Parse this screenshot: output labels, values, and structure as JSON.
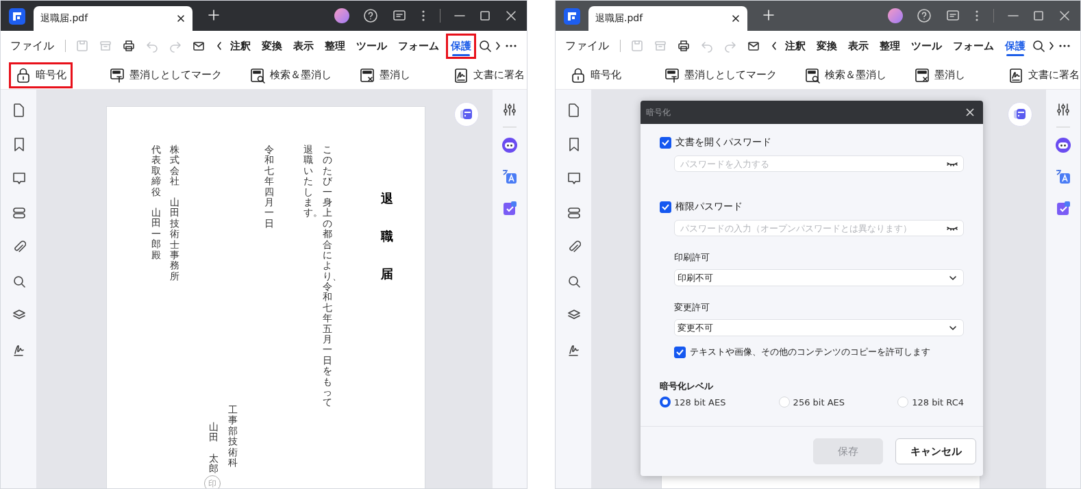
{
  "windows": [
    {
      "tab_title": "退職届.pdf",
      "menu": "ファイル",
      "quick_actions": [
        {
          "disabled": true
        },
        {
          "disabled": true
        },
        {
          "disabled": false
        },
        {
          "disabled": true
        },
        {
          "disabled": true
        },
        {
          "disabled": false
        }
      ],
      "tabs": [
        {
          "label": "注釈",
          "selected": false,
          "highlighted": false
        },
        {
          "label": "変換",
          "selected": false,
          "highlighted": false
        },
        {
          "label": "表示",
          "selected": false,
          "highlighted": false
        },
        {
          "label": "整理",
          "selected": false,
          "highlighted": false
        },
        {
          "label": "ツール",
          "selected": false,
          "highlighted": false
        },
        {
          "label": "フォーム",
          "selected": false,
          "highlighted": false
        },
        {
          "label": "保護",
          "selected": true,
          "highlighted": true
        }
      ],
      "tool_groups": [
        [
          {
            "label": "暗号化",
            "highlighted": true
          }
        ],
        [
          {
            "label": "墨消しとしてマーク",
            "highlighted": false
          },
          {
            "label": "検索＆墨消し",
            "highlighted": false
          },
          {
            "label": "墨消し",
            "highlighted": false
          }
        ],
        [
          {
            "label": "文書に署名",
            "highlighted": false
          }
        ]
      ],
      "document": {
        "columns": [
          {
            "kind": "text",
            "text": "代表取締役"
          },
          {
            "kind": "text",
            "text": "山田一郎殿"
          },
          {
            "kind": "text",
            "text": "株式会社"
          },
          {
            "kind": "text",
            "text": "山田技術士事務所"
          },
          {
            "kind": "text",
            "text": "山田"
          },
          {
            "kind": "text",
            "text": "太郎"
          },
          {
            "kind": "stamp",
            "text": "印"
          },
          {
            "kind": "text",
            "text": "工事部技術科"
          },
          {
            "kind": "text",
            "text": "令和七年四月一日"
          },
          {
            "kind": "text",
            "text": "退職いたします。"
          },
          {
            "kind": "text",
            "text": "このたび一身上の都合により、令和七年五月一日をもって"
          },
          {
            "kind": "title",
            "text": "退職届"
          }
        ]
      }
    },
    {
      "tab_title": "退職届.pdf",
      "menu": "ファイル",
      "quick_actions": [
        {
          "disabled": true
        },
        {
          "disabled": true
        },
        {
          "disabled": false
        },
        {
          "disabled": true
        },
        {
          "disabled": true
        },
        {
          "disabled": false
        }
      ],
      "tabs": [
        {
          "label": "注釈",
          "selected": false,
          "highlighted": false
        },
        {
          "label": "変換",
          "selected": false,
          "highlighted": false
        },
        {
          "label": "表示",
          "selected": false,
          "highlighted": false
        },
        {
          "label": "整理",
          "selected": false,
          "highlighted": false
        },
        {
          "label": "ツール",
          "selected": false,
          "highlighted": false
        },
        {
          "label": "フォーム",
          "selected": false,
          "highlighted": false
        },
        {
          "label": "保護",
          "selected": true,
          "highlighted": false
        }
      ],
      "tool_groups": [
        [
          {
            "label": "暗号化",
            "highlighted": false
          }
        ],
        [
          {
            "label": "墨消しとしてマーク",
            "highlighted": false
          },
          {
            "label": "検索＆墨消し",
            "highlighted": false
          },
          {
            "label": "墨消し",
            "highlighted": false
          }
        ],
        [
          {
            "label": "文書に署名",
            "highlighted": false
          }
        ]
      ],
      "dialog": {
        "title": "暗号化",
        "open_password": {
          "label": "文書を開くパスワード",
          "checked": true,
          "placeholder": "パスワードを入力する"
        },
        "permission_password": {
          "label": "権限パスワード",
          "checked": true,
          "placeholder": "パスワードの入力（オープンパスワードとは異なります）"
        },
        "print_permission": {
          "label": "印刷許可",
          "value": "印刷不可"
        },
        "change_permission": {
          "label": "変更許可",
          "value": "変更不可"
        },
        "copy": {
          "label": "テキストや画像、その他のコンテンツのコピーを許可します",
          "checked": true
        },
        "level_label": "暗号化レベル",
        "levels": [
          {
            "label": "128 bit AES",
            "selected": true
          },
          {
            "label": "256 bit AES",
            "selected": false
          },
          {
            "label": "128 bit RC4",
            "selected": false
          }
        ],
        "buttons": [
          {
            "label": "保存",
            "disabled": true
          },
          {
            "label": "キャンセル",
            "disabled": false
          }
        ]
      }
    }
  ]
}
